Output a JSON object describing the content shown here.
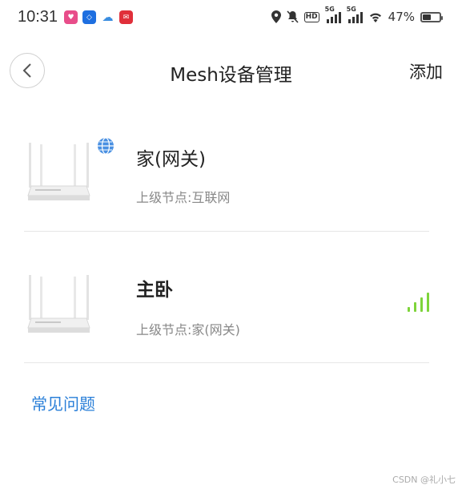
{
  "status_bar": {
    "time": "10:31",
    "battery": "47%",
    "network_1": "5G",
    "network_2": "5G",
    "hd_label": "HD"
  },
  "header": {
    "title": "Mesh设备管理",
    "add_label": "添加"
  },
  "devices": [
    {
      "name": "家(网关)",
      "parent": "上级节点:互联网",
      "is_gateway": true
    },
    {
      "name": "主卧",
      "parent": "上级节点:家(网关)",
      "signal_bars": 4
    }
  ],
  "faq_label": "常见问题",
  "watermark": "CSDN @礼小七",
  "colors": {
    "accent": "#2a7fd8",
    "signal": "#7ed43a",
    "globe": "#4a90e2"
  }
}
